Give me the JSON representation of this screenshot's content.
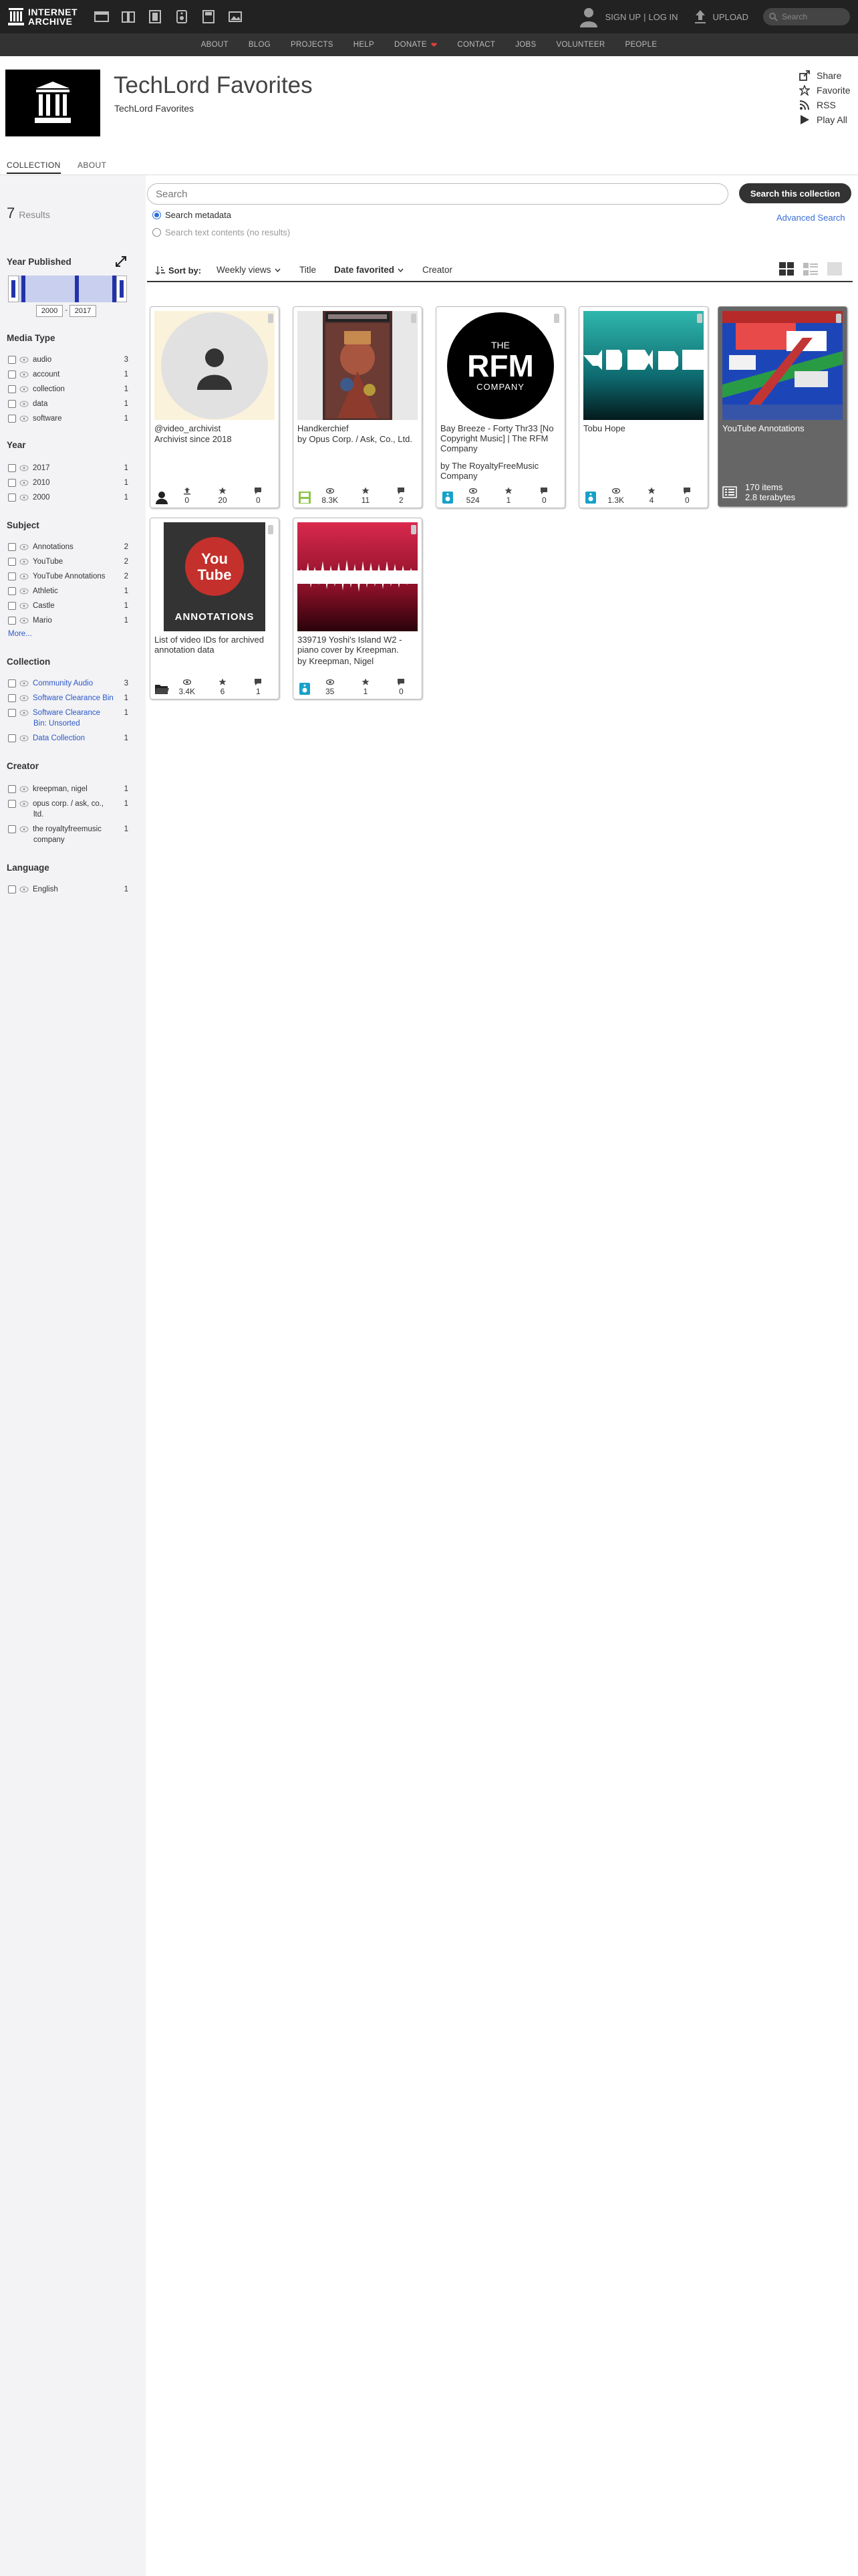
{
  "topbar": {
    "logo_line1": "INTERNET",
    "logo_line2": "ARCHIVE",
    "signup": "SIGN UP",
    "separator": "|",
    "login": "LOG IN",
    "upload": "UPLOAD",
    "search_placeholder": "Search"
  },
  "subnav": [
    "ABOUT",
    "BLOG",
    "PROJECTS",
    "HELP",
    "DONATE",
    "CONTACT",
    "JOBS",
    "VOLUNTEER",
    "PEOPLE"
  ],
  "collection": {
    "title": "TechLord Favorites",
    "subtitle": "TechLord Favorites",
    "actions": [
      "Share",
      "Favorite",
      "RSS",
      "Play All"
    ]
  },
  "tabs": [
    "COLLECTION",
    "ABOUT"
  ],
  "sidebar": {
    "results_count": "7",
    "results_label": "Results",
    "year_published": {
      "label": "Year Published",
      "min": "2000",
      "max": "2017",
      "dash": "-"
    },
    "media_type": {
      "label": "Media Type",
      "items": [
        {
          "label": "audio",
          "count": "3"
        },
        {
          "label": "account",
          "count": "1"
        },
        {
          "label": "collection",
          "count": "1"
        },
        {
          "label": "data",
          "count": "1"
        },
        {
          "label": "software",
          "count": "1"
        }
      ]
    },
    "year": {
      "label": "Year",
      "items": [
        {
          "label": "2017",
          "count": "1"
        },
        {
          "label": "2010",
          "count": "1"
        },
        {
          "label": "2000",
          "count": "1"
        }
      ]
    },
    "subject": {
      "label": "Subject",
      "items": [
        {
          "label": "Annotations",
          "count": "2"
        },
        {
          "label": "YouTube",
          "count": "2"
        },
        {
          "label": "YouTube Annotations",
          "count": "2"
        },
        {
          "label": "Athletic",
          "count": "1"
        },
        {
          "label": "Castle",
          "count": "1"
        },
        {
          "label": "Mario",
          "count": "1"
        }
      ],
      "more": "More..."
    },
    "collection": {
      "label": "Collection",
      "items": [
        {
          "label": "Community Audio",
          "count": "3"
        },
        {
          "label": "Software Clearance Bin",
          "count": "1"
        },
        {
          "label": "Software Clearance",
          "label2": "Bin: Unsorted",
          "count": "1"
        },
        {
          "label": "Data Collection",
          "count": "1"
        }
      ]
    },
    "creator": {
      "label": "Creator",
      "items": [
        {
          "label": "kreepman, nigel",
          "count": "1"
        },
        {
          "label": "opus corp. / ask, co.,",
          "label2": "ltd.",
          "count": "1"
        },
        {
          "label": "the royaltyfreemusic",
          "label2": "company",
          "count": "1"
        }
      ]
    },
    "language": {
      "label": "Language",
      "items": [
        {
          "label": "English",
          "count": "1"
        }
      ]
    }
  },
  "search": {
    "placeholder": "Search",
    "button": "Search this collection",
    "opt_metadata": "Search metadata",
    "opt_text": "Search text contents (no results)",
    "advanced": "Advanced Search"
  },
  "sort": {
    "label": "Sort by:",
    "options": [
      "Weekly views",
      "Title",
      "Date favorited",
      "Creator"
    ],
    "selected": "Date favorited"
  },
  "tiles": [
    {
      "title": "@video_archivist",
      "title2": "Archivist since 2018",
      "by": "",
      "type": "account-icon",
      "stats": [
        "0",
        "20",
        "0"
      ]
    },
    {
      "title": "Handkerchief",
      "by": "by Opus Corp. / Ask, Co., Ltd.",
      "type": "software-icon",
      "stats": [
        "8.3K",
        "11",
        "2"
      ]
    },
    {
      "title": "Bay Breeze - Forty Thr33 [No Copyright Music] | The RFM Company",
      "by": "by The RoyaltyFreeMusic Company",
      "type": "audio-icon",
      "stats": [
        "524",
        "1",
        "0"
      ],
      "thumb_top": "THE",
      "thumb_big": "RFM",
      "thumb_bottom": "COMPANY"
    },
    {
      "title": "Tobu Hope",
      "by": "",
      "type": "audio-icon",
      "stats": [
        "1.3K",
        "4",
        "0"
      ]
    },
    {
      "title": "List of video IDs for archived annotation data",
      "by": "",
      "type": "data-icon",
      "stats": [
        "3.4K",
        "6",
        "1"
      ],
      "thumb_you": "You",
      "thumb_tube": "Tube",
      "thumb_text": "ANNOTATIONS"
    },
    {
      "title": "339719 Yoshi's Island W2 - piano cover by Kreepman.",
      "by": "by Kreepman, Nigel",
      "type": "audio-icon",
      "stats": [
        "35",
        "1",
        "0"
      ]
    }
  ],
  "collection_tile": {
    "title": "YouTube Annotations",
    "items": "170 items",
    "size": "2.8 terabytes"
  },
  "colors": {
    "accent_blue": "#2b58c9",
    "audio_teal": "#16a1c9",
    "software_green": "#8dc44a"
  }
}
